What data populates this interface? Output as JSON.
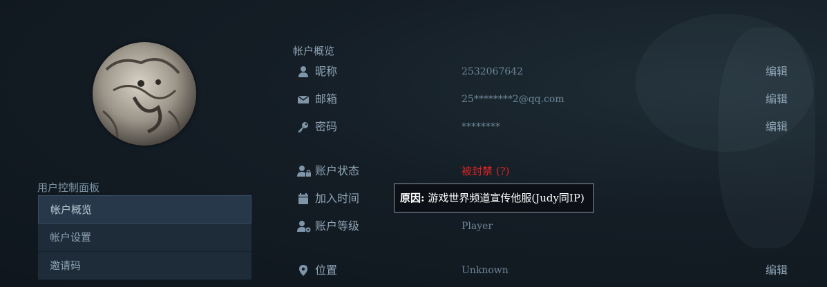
{
  "colors": {
    "banned": "#e02424",
    "background": "#141d25"
  },
  "sidebar": {
    "title": "用户控制面板",
    "items": [
      {
        "label": "帐户概览",
        "active": true
      },
      {
        "label": "帐户设置",
        "active": false
      },
      {
        "label": "邀请码",
        "active": false
      }
    ]
  },
  "overview": {
    "title": "帐户概览",
    "nickname": {
      "icon": "user-icon",
      "label": "昵称",
      "value": "2532067642",
      "edit": "编辑"
    },
    "email": {
      "icon": "envelope-icon",
      "label": "邮箱",
      "value": "25********2@qq.com",
      "edit": "编辑"
    },
    "password": {
      "icon": "key-icon",
      "label": "密码",
      "value": "********",
      "edit": "编辑"
    },
    "status": {
      "icon": "user-lock-icon",
      "label": "账户状态",
      "value": "被封禁 (?)"
    },
    "joined": {
      "icon": "calendar-icon",
      "label": "加入时间"
    },
    "level": {
      "icon": "user-cog-icon",
      "label": "账户等级",
      "value": "Player"
    },
    "location": {
      "icon": "map-pin-icon",
      "label": "位置",
      "value": "Unknown",
      "edit": "编辑"
    }
  },
  "tooltip": {
    "prefix": "原因:",
    "text": "游戏世界频道宣传他服(Judy同IP)"
  }
}
